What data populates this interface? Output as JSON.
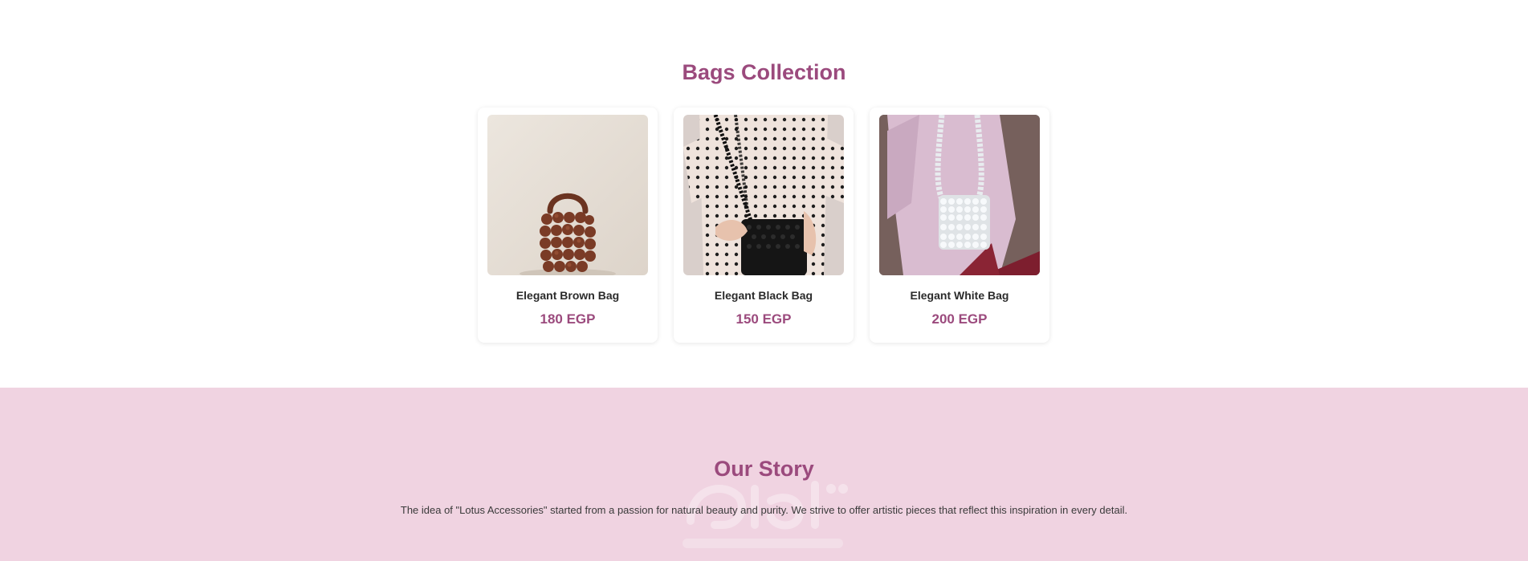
{
  "bags": {
    "title": "Bags Collection",
    "items": [
      {
        "name": "Elegant Brown Bag",
        "price": "180 EGP"
      },
      {
        "name": "Elegant Black Bag",
        "price": "150 EGP"
      },
      {
        "name": "Elegant White Bag",
        "price": "200 EGP"
      }
    ]
  },
  "story": {
    "title": "Our Story",
    "text": "The idea of \"Lotus Accessories\" started from a passion for natural beauty and purity. We strive to offer artistic pieces that reflect this inspiration in every detail."
  },
  "colors": {
    "accent": "#9b4a7d",
    "story_background": "#f0d3e1"
  }
}
